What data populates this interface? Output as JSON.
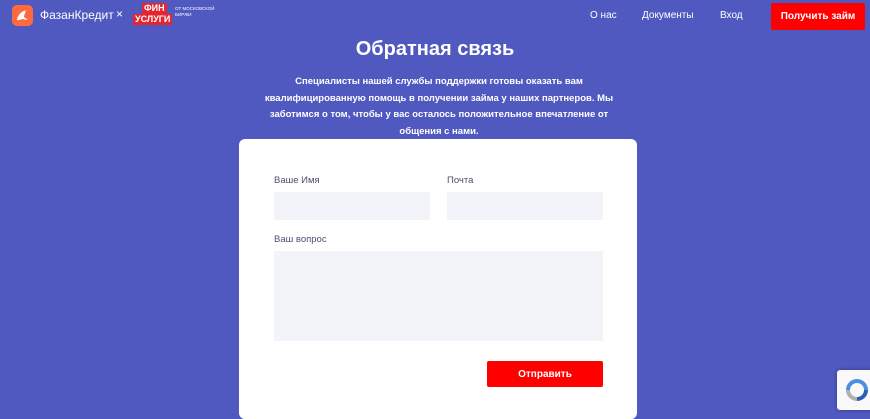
{
  "header": {
    "brand": "ФазанКредит",
    "times": "×",
    "fin_line1": "ФИН",
    "fin_line2": "УСЛУГИ",
    "fin_sub": "ОТ МОСКОВСКОЙ БИРЖИ",
    "nav": [
      "О нас",
      "Документы",
      "Вход"
    ],
    "cta": "Получить займ"
  },
  "main": {
    "title": "Обратная связь",
    "description": "Специалисты нашей службы поддержки готовы оказать вам квалифицированную помощь в получении займа у наших партнеров. Мы заботимся о том, чтобы у вас осталось положительное впечатление от общения с нами."
  },
  "form": {
    "name_label": "Ваше Имя",
    "name_value": "",
    "email_label": "Почта",
    "email_value": "",
    "question_label": "Ваш вопрос",
    "question_value": "",
    "submit": "Отправить"
  },
  "colors": {
    "background": "#5059c0",
    "accent": "#ff0000",
    "logo": "#ff6a3d",
    "field": "#f3f4f9"
  },
  "icons": [
    "pheasant-logo-icon",
    "recaptcha-icon"
  ]
}
